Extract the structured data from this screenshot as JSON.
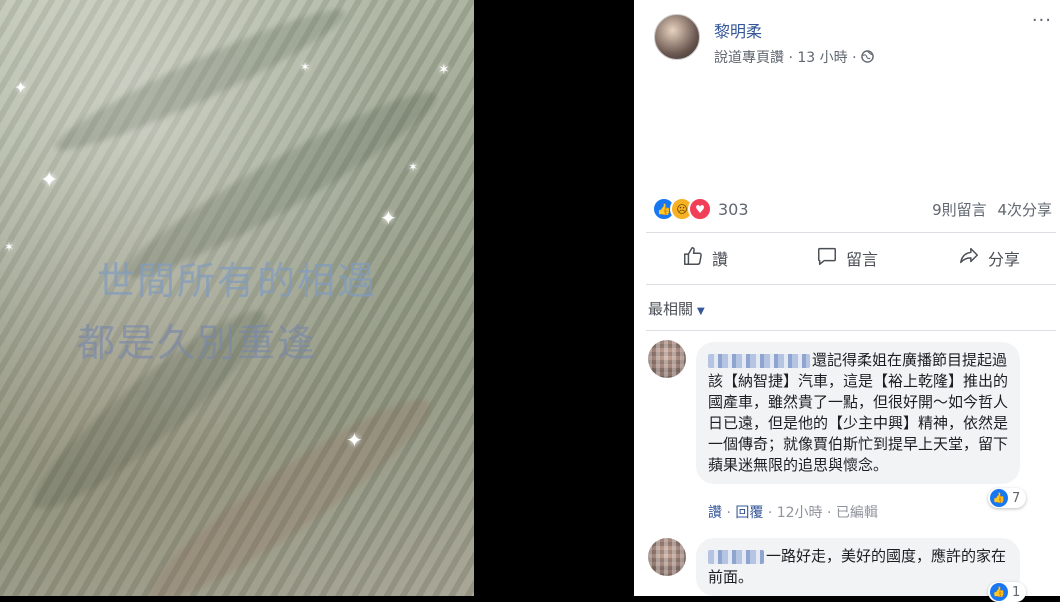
{
  "photo": {
    "line1": "世間所有的相遇",
    "line2": "都是久別重逢"
  },
  "post": {
    "author": "黎明柔",
    "meta": "說道專頁讚 · 13 小時 · ",
    "globe_icon": "globe-icon",
    "more_label": "···",
    "reaction_count": "303",
    "comments_count": "9則留言",
    "shares_count": "4次分享"
  },
  "actions": {
    "like": "讚",
    "comment": "留言",
    "share": "分享"
  },
  "sort_label": "最相關",
  "comments": [
    {
      "text": "還記得柔姐在廣播節目提起過該【納智捷】汽車，這是【裕上乾隆】推出的國產車，雖然貴了一點，但很好開～如今哲人日已遠，但是他的【少主中興】精神，依然是一個傳奇；就像賈伯斯忙到提早上天堂，留下蘋果迷無限的追思與懷念。",
      "likes": "7",
      "like_link": "讚",
      "reply_link": "回覆",
      "time": "12小時",
      "edited": "已編輯"
    },
    {
      "text": "一路好走，美好的國度，應許的家在前面。",
      "likes": "1"
    }
  ],
  "colors": {
    "link": "#365899",
    "muted": "#606770",
    "like_blue": "#1877f2",
    "love_red": "#f33e58",
    "sad_yellow": "#f7b125",
    "bubble_bg": "#f2f3f5"
  }
}
